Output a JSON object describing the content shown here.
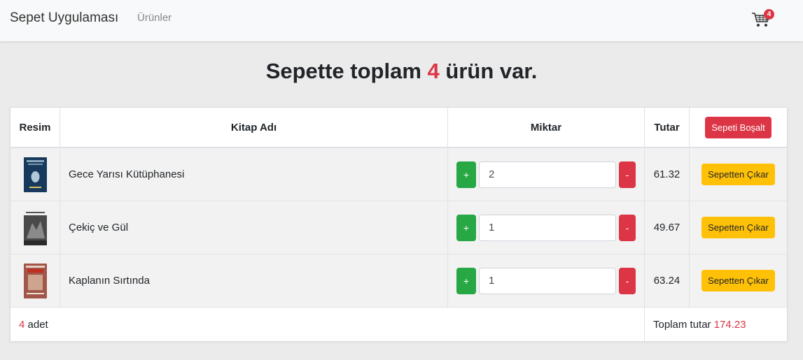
{
  "navbar": {
    "brand": "Sepet Uygulaması",
    "link": "Ürünler",
    "cart_count": "4"
  },
  "headline": {
    "prefix": "Sepette toplam ",
    "count": "4",
    "suffix": " ürün var."
  },
  "table": {
    "headers": {
      "resim": "Resim",
      "kitap_adi": "Kitap Adı",
      "miktar": "Miktar",
      "tutar": "Tutar",
      "empty_button": "Sepeti Boşalt"
    },
    "rows": [
      {
        "title": "Gece Yarısı Kütüphanesi",
        "quantity": "2",
        "total": "61.32",
        "plus": "+",
        "minus": "-",
        "remove": "Sepetten Çıkar",
        "cover_color": "#173a5c"
      },
      {
        "title": "Çekiç ve Gül",
        "quantity": "1",
        "total": "49.67",
        "plus": "+",
        "minus": "-",
        "remove": "Sepetten Çıkar",
        "cover_color": "#4a4a4a"
      },
      {
        "title": "Kaplanın Sırtında",
        "quantity": "1",
        "total": "63.24",
        "plus": "+",
        "minus": "-",
        "remove": "Sepetten Çıkar",
        "cover_color": "#a0574a"
      }
    ],
    "footer": {
      "count": "4",
      "count_label": " adet",
      "total_label": "Toplam tutar ",
      "total_value": "174.23"
    }
  },
  "colors": {
    "danger": "#dc3545",
    "success": "#28a745",
    "warning": "#ffc107"
  }
}
